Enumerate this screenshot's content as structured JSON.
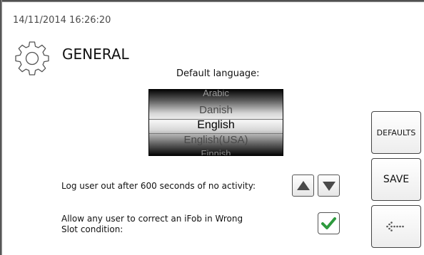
{
  "header": {
    "datetime": "14/11/2014 16:26:20",
    "title": "GENERAL",
    "icon": "gear-icon"
  },
  "language": {
    "label": "Default language:",
    "options": [
      "Arabic",
      "Danish",
      "English",
      "English(USA)",
      "Finnish"
    ],
    "selected": "English"
  },
  "timeout": {
    "label": "Log user out after 600 seconds of no activity:"
  },
  "wrong_slot": {
    "label": "Allow any user to correct an iFob in Wrong Slot condition:",
    "checked": true
  },
  "buttons": {
    "defaults": "DEFAULTS",
    "save": "SAVE",
    "back_icon": "back-arrow-icon"
  },
  "colors": {
    "check_green": "#2e9a3e"
  }
}
